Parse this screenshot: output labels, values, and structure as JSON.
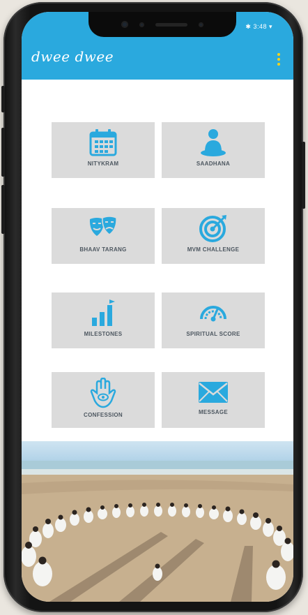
{
  "statusbar": {
    "text": "✱ 3:48 ▾"
  },
  "app": {
    "title": "dwee dwee"
  },
  "tiles": [
    {
      "label": "NITYKRAM",
      "icon": "calendar-icon"
    },
    {
      "label": "SAADHANA",
      "icon": "meditation-icon"
    },
    {
      "label": "BHAAV TARANG",
      "icon": "theatre-masks-icon"
    },
    {
      "label": "MVM CHALLENGE",
      "icon": "target-icon"
    },
    {
      "label": "MILESTONES",
      "icon": "bar-chart-icon"
    },
    {
      "label": "SPIRITUAL SCORE",
      "icon": "gauge-icon"
    },
    {
      "label": "CONFESSION",
      "icon": "hamsa-icon"
    },
    {
      "label": "MESSAGE",
      "icon": "envelope-icon"
    }
  ],
  "colors": {
    "appbar": "#2aa9de",
    "icon": "#2aa9de",
    "tile": "#dbdbdb",
    "kebab": "#f5d21a"
  }
}
